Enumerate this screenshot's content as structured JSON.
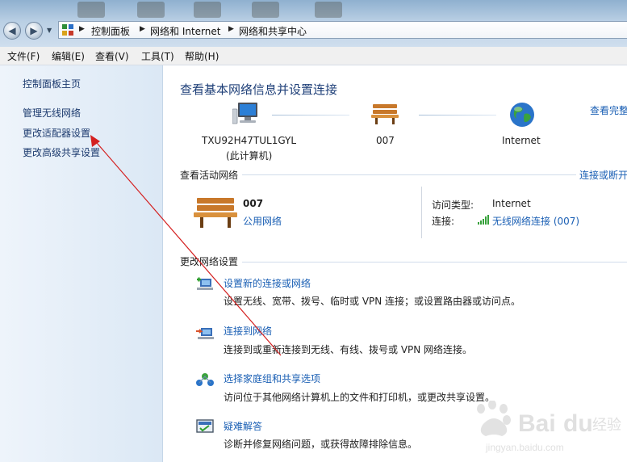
{
  "address": {
    "crumbs": [
      "控制面板",
      "网络和 Internet",
      "网络和共享中心"
    ]
  },
  "menu": [
    "文件(F)",
    "编辑(E)",
    "查看(V)",
    "工具(T)",
    "帮助(H)"
  ],
  "sidebar": {
    "items": [
      "控制面板主页",
      "管理无线网络",
      "更改适配器设置",
      "更改高级共享设置"
    ]
  },
  "main": {
    "title": "查看基本网络信息并设置连接",
    "see_full_map": "查看完整",
    "map": {
      "computer_name": "TXU92H47TUL1GYL",
      "computer_note": "(此计算机)",
      "network_name": "007",
      "internet_label": "Internet"
    },
    "active": {
      "header": "查看活动网络",
      "connect_disconnect": "连接或断开",
      "network_name": "007",
      "network_type": "公用网络",
      "access_type_label": "访问类型:",
      "access_type_value": "Internet",
      "connection_label": "连接:",
      "connection_value": "无线网络连接 (007)"
    },
    "change": {
      "header": "更改网络设置",
      "tasks": [
        {
          "link": "设置新的连接或网络",
          "desc": "设置无线、宽带、拨号、临时或 VPN 连接；或设置路由器或访问点。"
        },
        {
          "link": "连接到网络",
          "desc": "连接到或重新连接到无线、有线、拨号或 VPN 网络连接。"
        },
        {
          "link": "选择家庭组和共享选项",
          "desc": "访问位于其他网络计算机上的文件和打印机，或更改共享设置。"
        },
        {
          "link": "疑难解答",
          "desc": "诊断并修复网络问题，或获得故障排除信息。"
        }
      ]
    }
  },
  "watermark": {
    "logo": "Baidu经验",
    "url": "jingyan.baidu.com"
  },
  "colors": {
    "link": "#1a5fb4",
    "title": "#1e3f78",
    "annotation_arrow": "#d42020"
  }
}
